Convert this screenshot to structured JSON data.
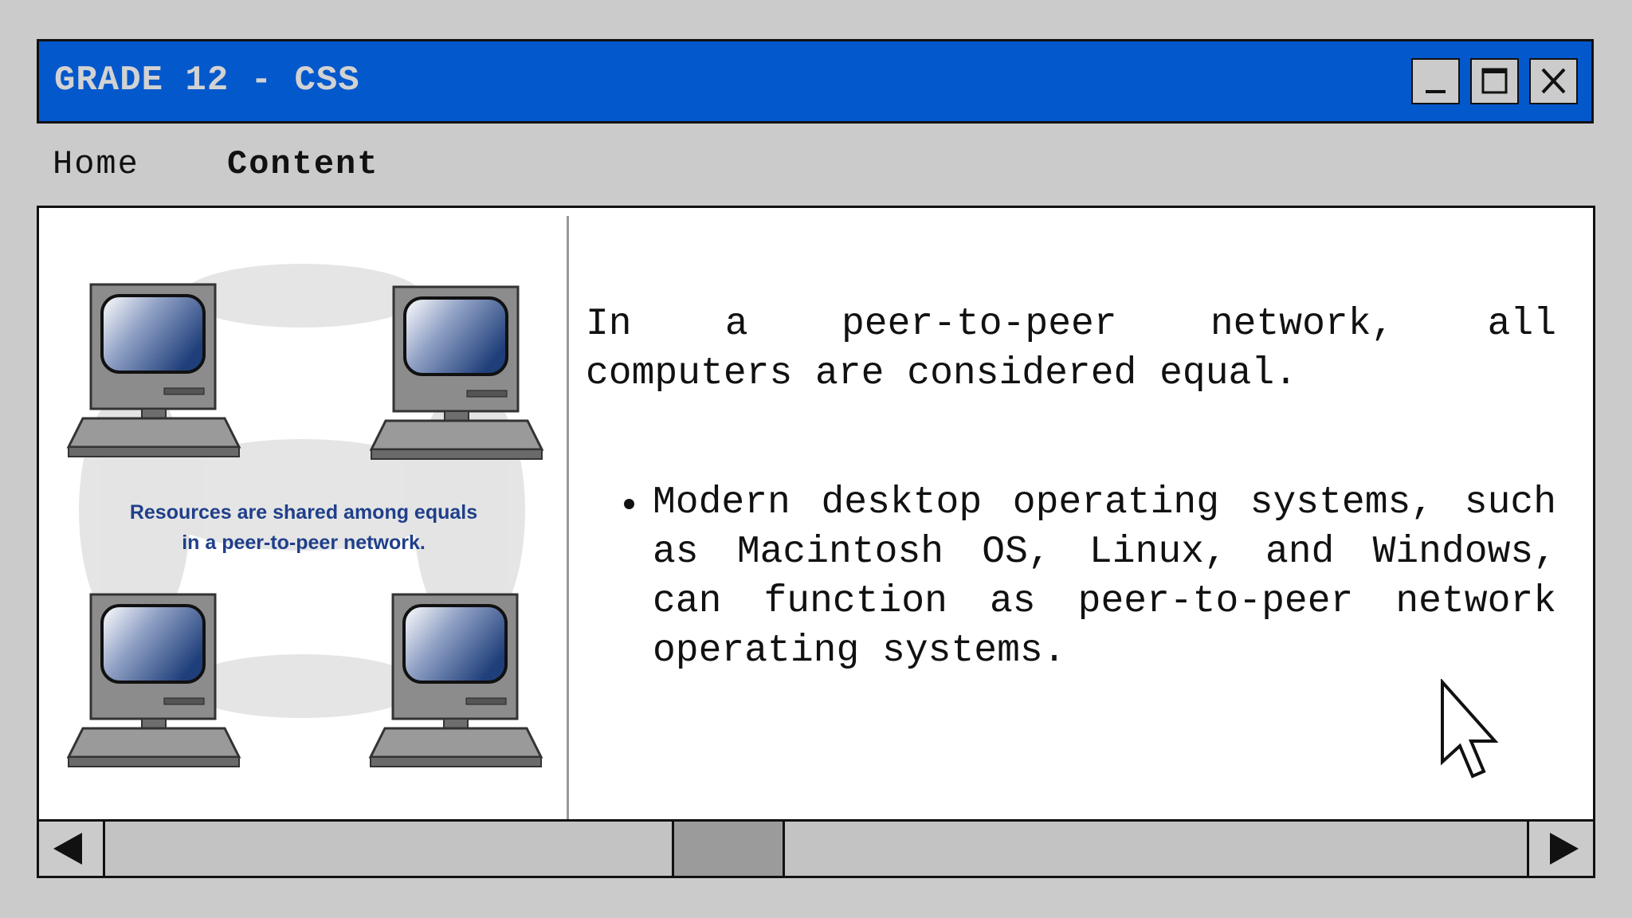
{
  "window": {
    "title": "GRADE 12 - CSS",
    "controls": {
      "minimize_icon": "minimize-icon",
      "maximize_icon": "maximize-icon",
      "close_icon": "close-icon"
    },
    "accent_color": "#0358cc"
  },
  "menu": {
    "items": [
      {
        "label": "Home",
        "active": false
      },
      {
        "label": "Content",
        "active": true
      }
    ]
  },
  "illustration": {
    "caption_line1": "Resources are shared among equals",
    "caption_line2": "in a peer-to-peer network.",
    "icon": "computer-icon"
  },
  "content": {
    "lead_line1": "In a peer-to-peer network, all",
    "lead_line2": "computers are considered equal.",
    "bullets": [
      "Modern desktop operating systems, such as Macintosh OS, Linux, and Windows, can function as peer-to-peer network operating systems."
    ]
  },
  "scrollbar": {
    "left_icon": "arrow-left-icon",
    "right_icon": "arrow-right-icon"
  }
}
